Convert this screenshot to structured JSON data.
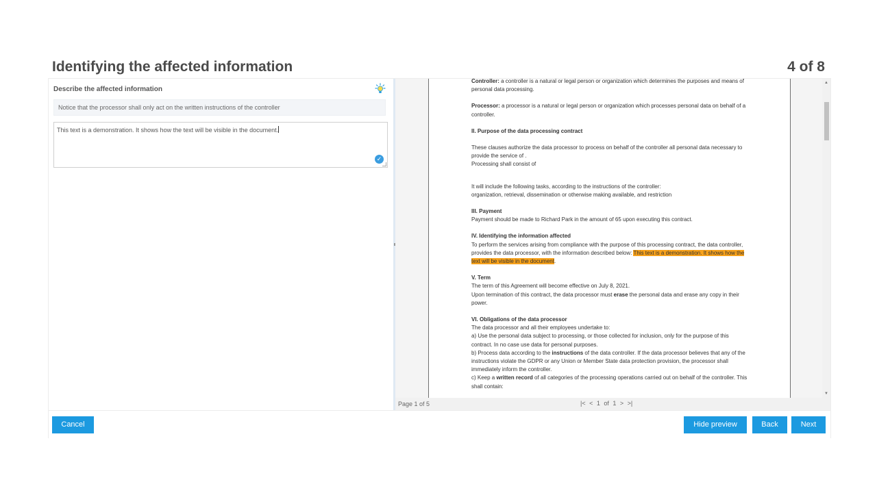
{
  "header": {
    "title": "Identifying the affected information",
    "step": "4 of 8"
  },
  "left": {
    "label": "Describe the affected information",
    "hint": "Notice that the processor shall only act on the written instructions of the controller",
    "text_value": "This text is a demonstration. It shows how the text will be visible in the document."
  },
  "doc": {
    "controller_term": "Controller:",
    "controller_text": " a controller is a natural or legal person or organization which determines the purposes and means of personal data processing.",
    "processor_term": "Processor:",
    "processor_text": " a processor is a natural or legal person or organization which processes personal data on behalf of a controller.",
    "s2_title": "II. Purpose of the data processing contract",
    "s2_p1": "These clauses authorize the data processor to process on behalf of the controller all personal data necessary to provide the service of .",
    "s2_p2": "Processing shall consist of",
    "s2_p3a": "It will include the following tasks, according to the instructions of the controller:",
    "s2_p3b": "organization, retrieval, dissemination or otherwise making available, and restriction",
    "s3_title": "III. Payment",
    "s3_text": "Payment should be made to Richard Park  in the amount of 65 upon executing this contract.",
    "s4_title": "IV. Identifying the information affected",
    "s4_text": "To perform the services arising from compliance with the purpose of this processing contract, the data controller, provides the data processor, with the information described below: ",
    "s4_highlight": "This text is a demonstration. It shows how the text will be visible in the document",
    "s4_end": ".",
    "s5_title": "V. Term",
    "s5_p1": "The term of this Agreement will become effective on July 8,  2021.",
    "s5_p2a": "Upon termination of this contract, the data processor must ",
    "s5_p2b": "erase",
    "s5_p2c": " the personal data and erase any copy in their power.",
    "s6_title": "VI. Obligations of the data processor",
    "s6_intro": "The data processor and all their employees undertake to:",
    "s6_a": "a) Use the personal data subject to processing, or those collected for inclusion, only for the purpose of this contract. In no case use data for personal purposes.",
    "s6_b1": "b) Process data according to the ",
    "s6_b2": "instructions",
    "s6_b3": " of the data controller. If the data processor believes that any of the instructions violate the GDPR or any Union or Member State data protection provision, the processor shall immediately inform the controller.",
    "s6_c1": "c) Keep a ",
    "s6_c2": "written record",
    "s6_c3": " of all categories of the processing operations carried out on behalf of the controller. This shall contain:"
  },
  "pager": {
    "page_label": "Page 1 of 5",
    "nav": "|< < 1 of 1 > >|"
  },
  "buttons": {
    "cancel": "Cancel",
    "hide_preview": "Hide preview",
    "back": "Back",
    "next": "Next"
  },
  "colors": {
    "accent": "#1c9ae0",
    "highlight": "#f7a11a"
  },
  "icons": [
    "lightbulb-icon",
    "check-circle-icon"
  ]
}
